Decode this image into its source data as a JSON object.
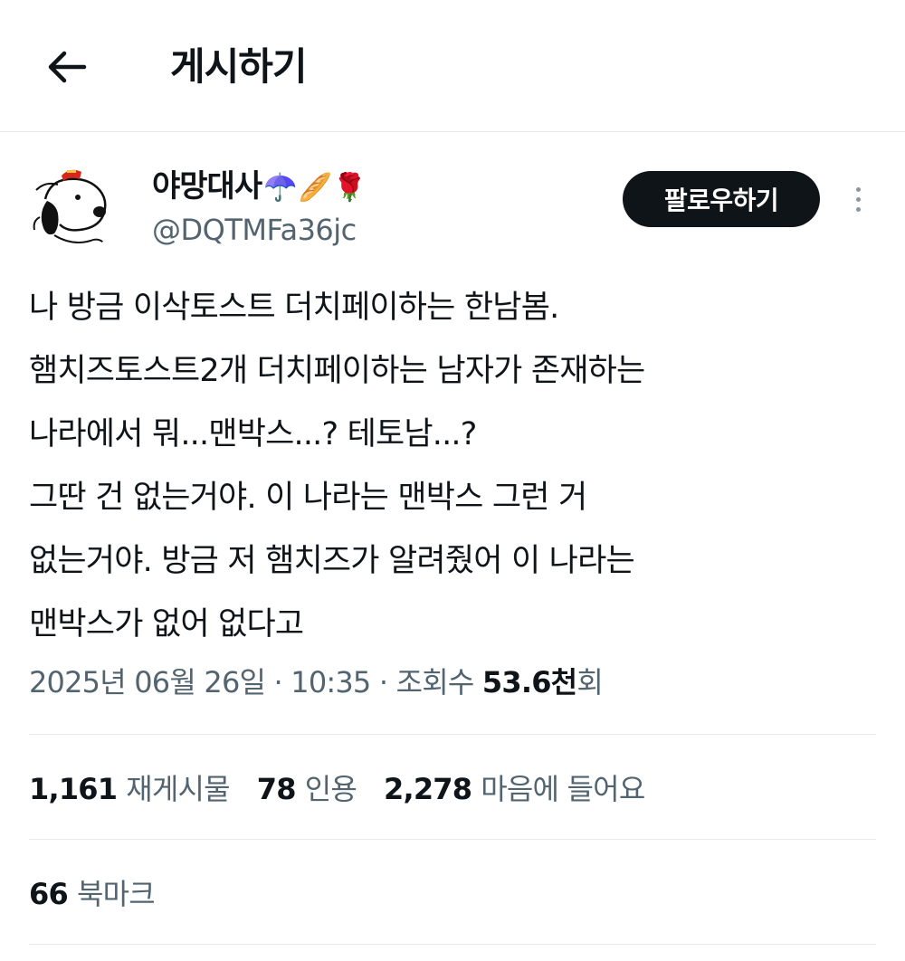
{
  "header": {
    "title": "게시하기",
    "back_icon": "arrow-left-icon"
  },
  "author": {
    "display_name": "야망대사",
    "emojis": [
      "☂️",
      "🥖",
      "🌹"
    ],
    "handle": "@DQTMFa36jc",
    "avatar": "snoopy-avatar"
  },
  "actions": {
    "follow_label": "팔로우하기",
    "more_icon": "more-vertical-icon"
  },
  "tweet": {
    "lines": [
      "나 방금 이삭토스트 더치페이하는 한남봄.",
      "햄치즈토스트2개 더치페이하는 남자가 존재하는",
      "나라에서 뭐...맨박스...? 테토남...?",
      "그딴 건 없는거야. 이 나라는 맨박스 그런 거",
      "없는거야. 방금 저 햄치즈가 알려줬어 이 나라는",
      "맨박스가 없어 없다고"
    ]
  },
  "meta": {
    "date": "2025년 06월 26일",
    "separator": " · ",
    "time": "10:35",
    "views_label": "조회수",
    "views_count": "53.6천",
    "views_suffix": "회"
  },
  "stats": {
    "reposts": {
      "count": "1,161",
      "label": "재게시물"
    },
    "quotes": {
      "count": "78",
      "label": "인용"
    },
    "likes": {
      "count": "2,278",
      "label": "마음에 들어요"
    },
    "bookmarks": {
      "count": "66",
      "label": "북마크"
    }
  },
  "colors": {
    "text_primary": "#0f1419",
    "text_secondary": "#536471",
    "divider": "#e6e9eb",
    "follow_bg": "#0f1419"
  }
}
